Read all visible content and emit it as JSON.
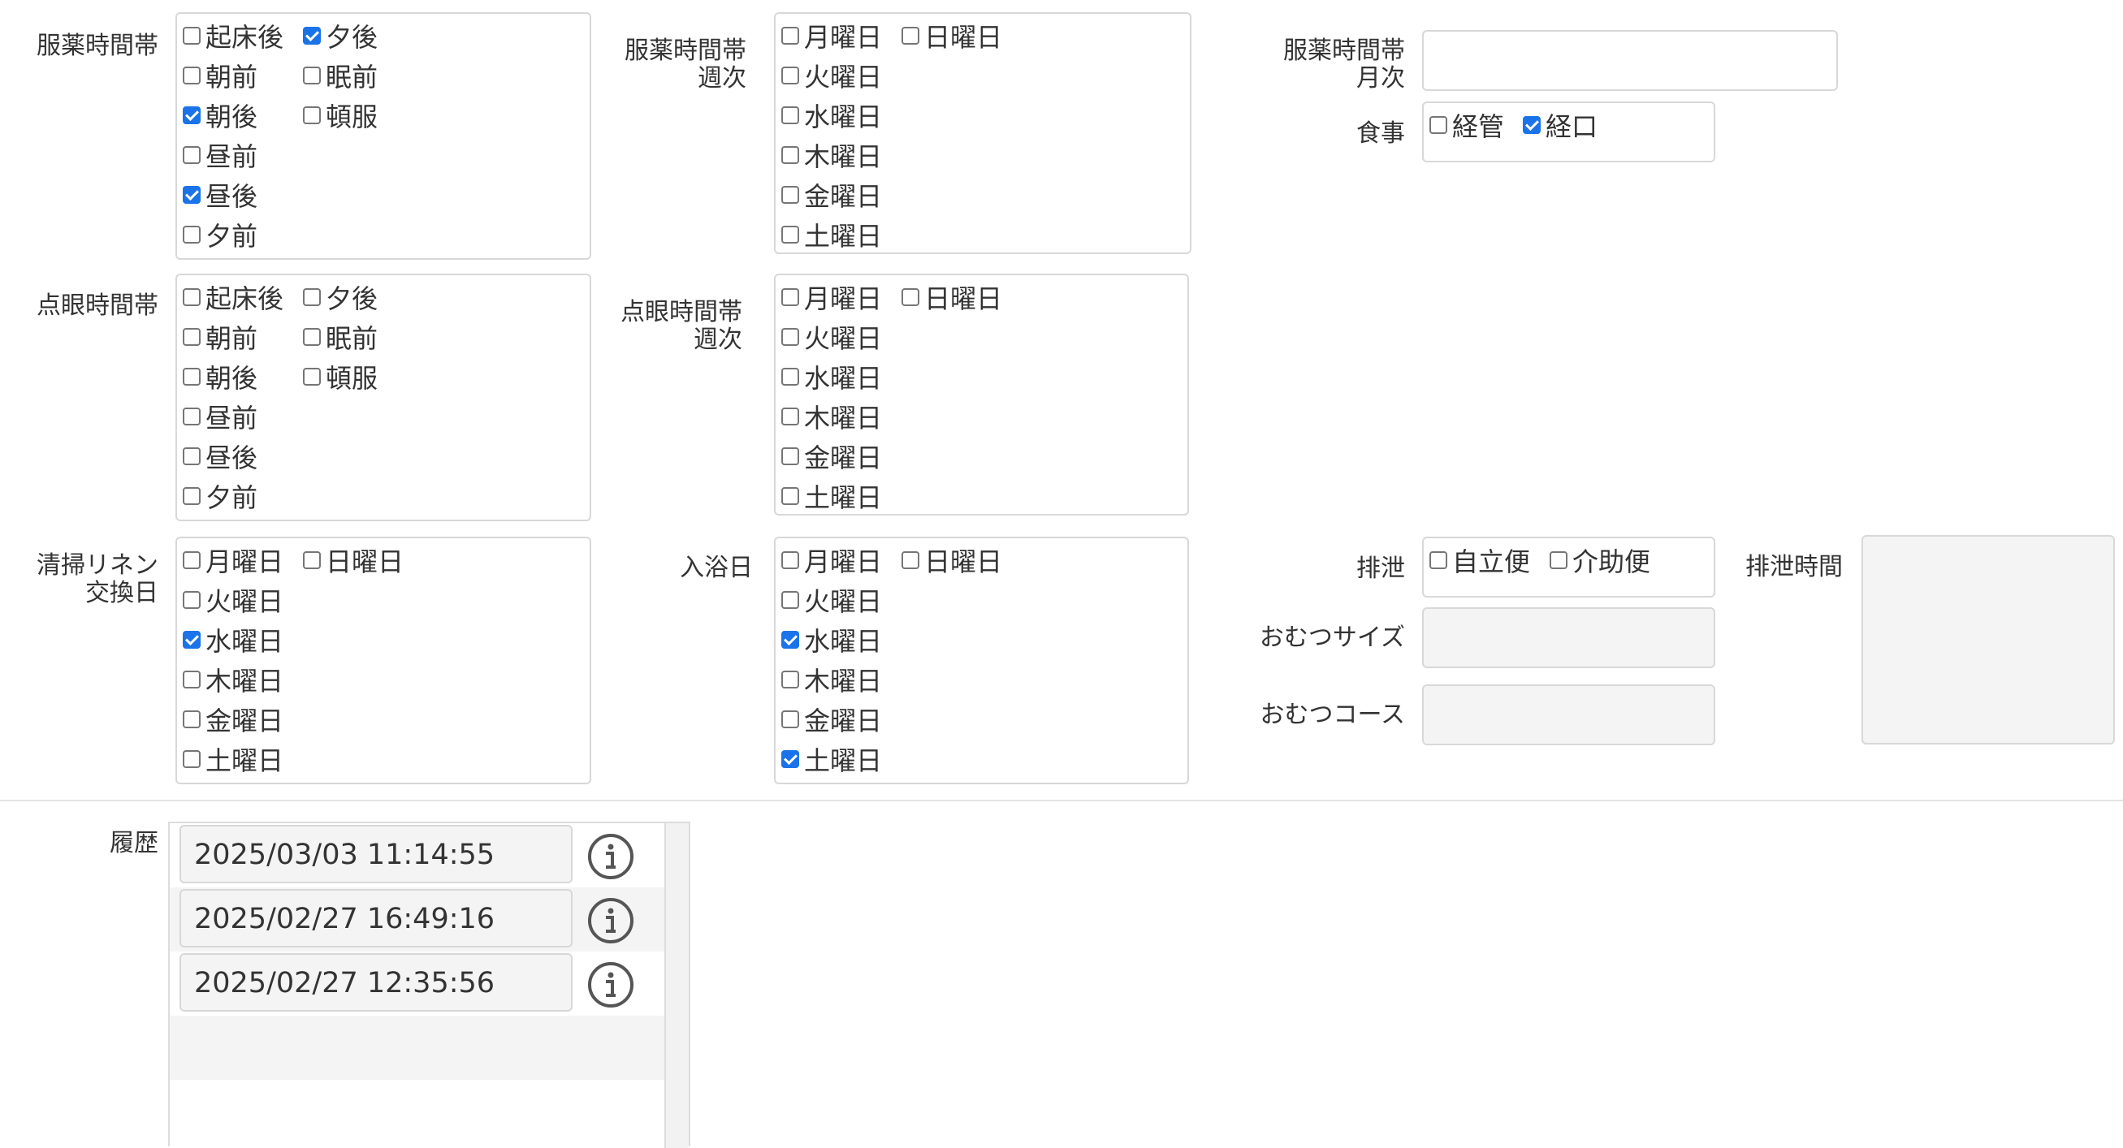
{
  "days": [
    "月曜日",
    "日曜日",
    "火曜日",
    "水曜日",
    "木曜日",
    "金曜日",
    "土曜日"
  ],
  "times": [
    "起床後",
    "夕後",
    "朝前",
    "眠前",
    "朝後",
    "頓服",
    "昼前",
    "昼後",
    "夕前"
  ],
  "medication": {
    "time_label": "服薬時間帯",
    "weekly_label_1": "服薬時間帯",
    "weekly_label_2": "週次",
    "monthly_label_1": "服薬時間帯",
    "monthly_label_2": "月次",
    "monthly_value": ""
  },
  "meal": {
    "label": "食事",
    "options": [
      "経管",
      "経口"
    ]
  },
  "eyedrop": {
    "time_label": "点眼時間帯",
    "weekly_label_1": "点眼時間帯",
    "weekly_label_2": "週次"
  },
  "linen": {
    "label_1": "清掃リネン",
    "label_2": "交換日"
  },
  "bath": {
    "label": "入浴日"
  },
  "excretion": {
    "label": "排泄",
    "options": [
      "自立便",
      "介助便"
    ],
    "time_label": "排泄時間",
    "time_value": ""
  },
  "diaper": {
    "size_label": "おむつサイズ",
    "size_value": "",
    "course_label": "おむつコース",
    "course_value": ""
  },
  "history": {
    "label": "履歴",
    "entries": [
      "2025/03/03 11:14:55",
      "2025/02/27 16:49:16",
      "2025/02/27 12:35:56"
    ]
  },
  "checked": {
    "med_time": [
      "夕後",
      "朝後",
      "昼後"
    ],
    "med_week": [],
    "eye_time": [],
    "eye_week": [],
    "linen": [
      "水曜日"
    ],
    "bath": [
      "水曜日",
      "土曜日"
    ],
    "meal": [
      "経口"
    ],
    "excretion": []
  },
  "colors": {
    "checkbox_checked": "#1a73e8",
    "border": "#d8d8d8",
    "field_bg": "#f4f4f4"
  }
}
